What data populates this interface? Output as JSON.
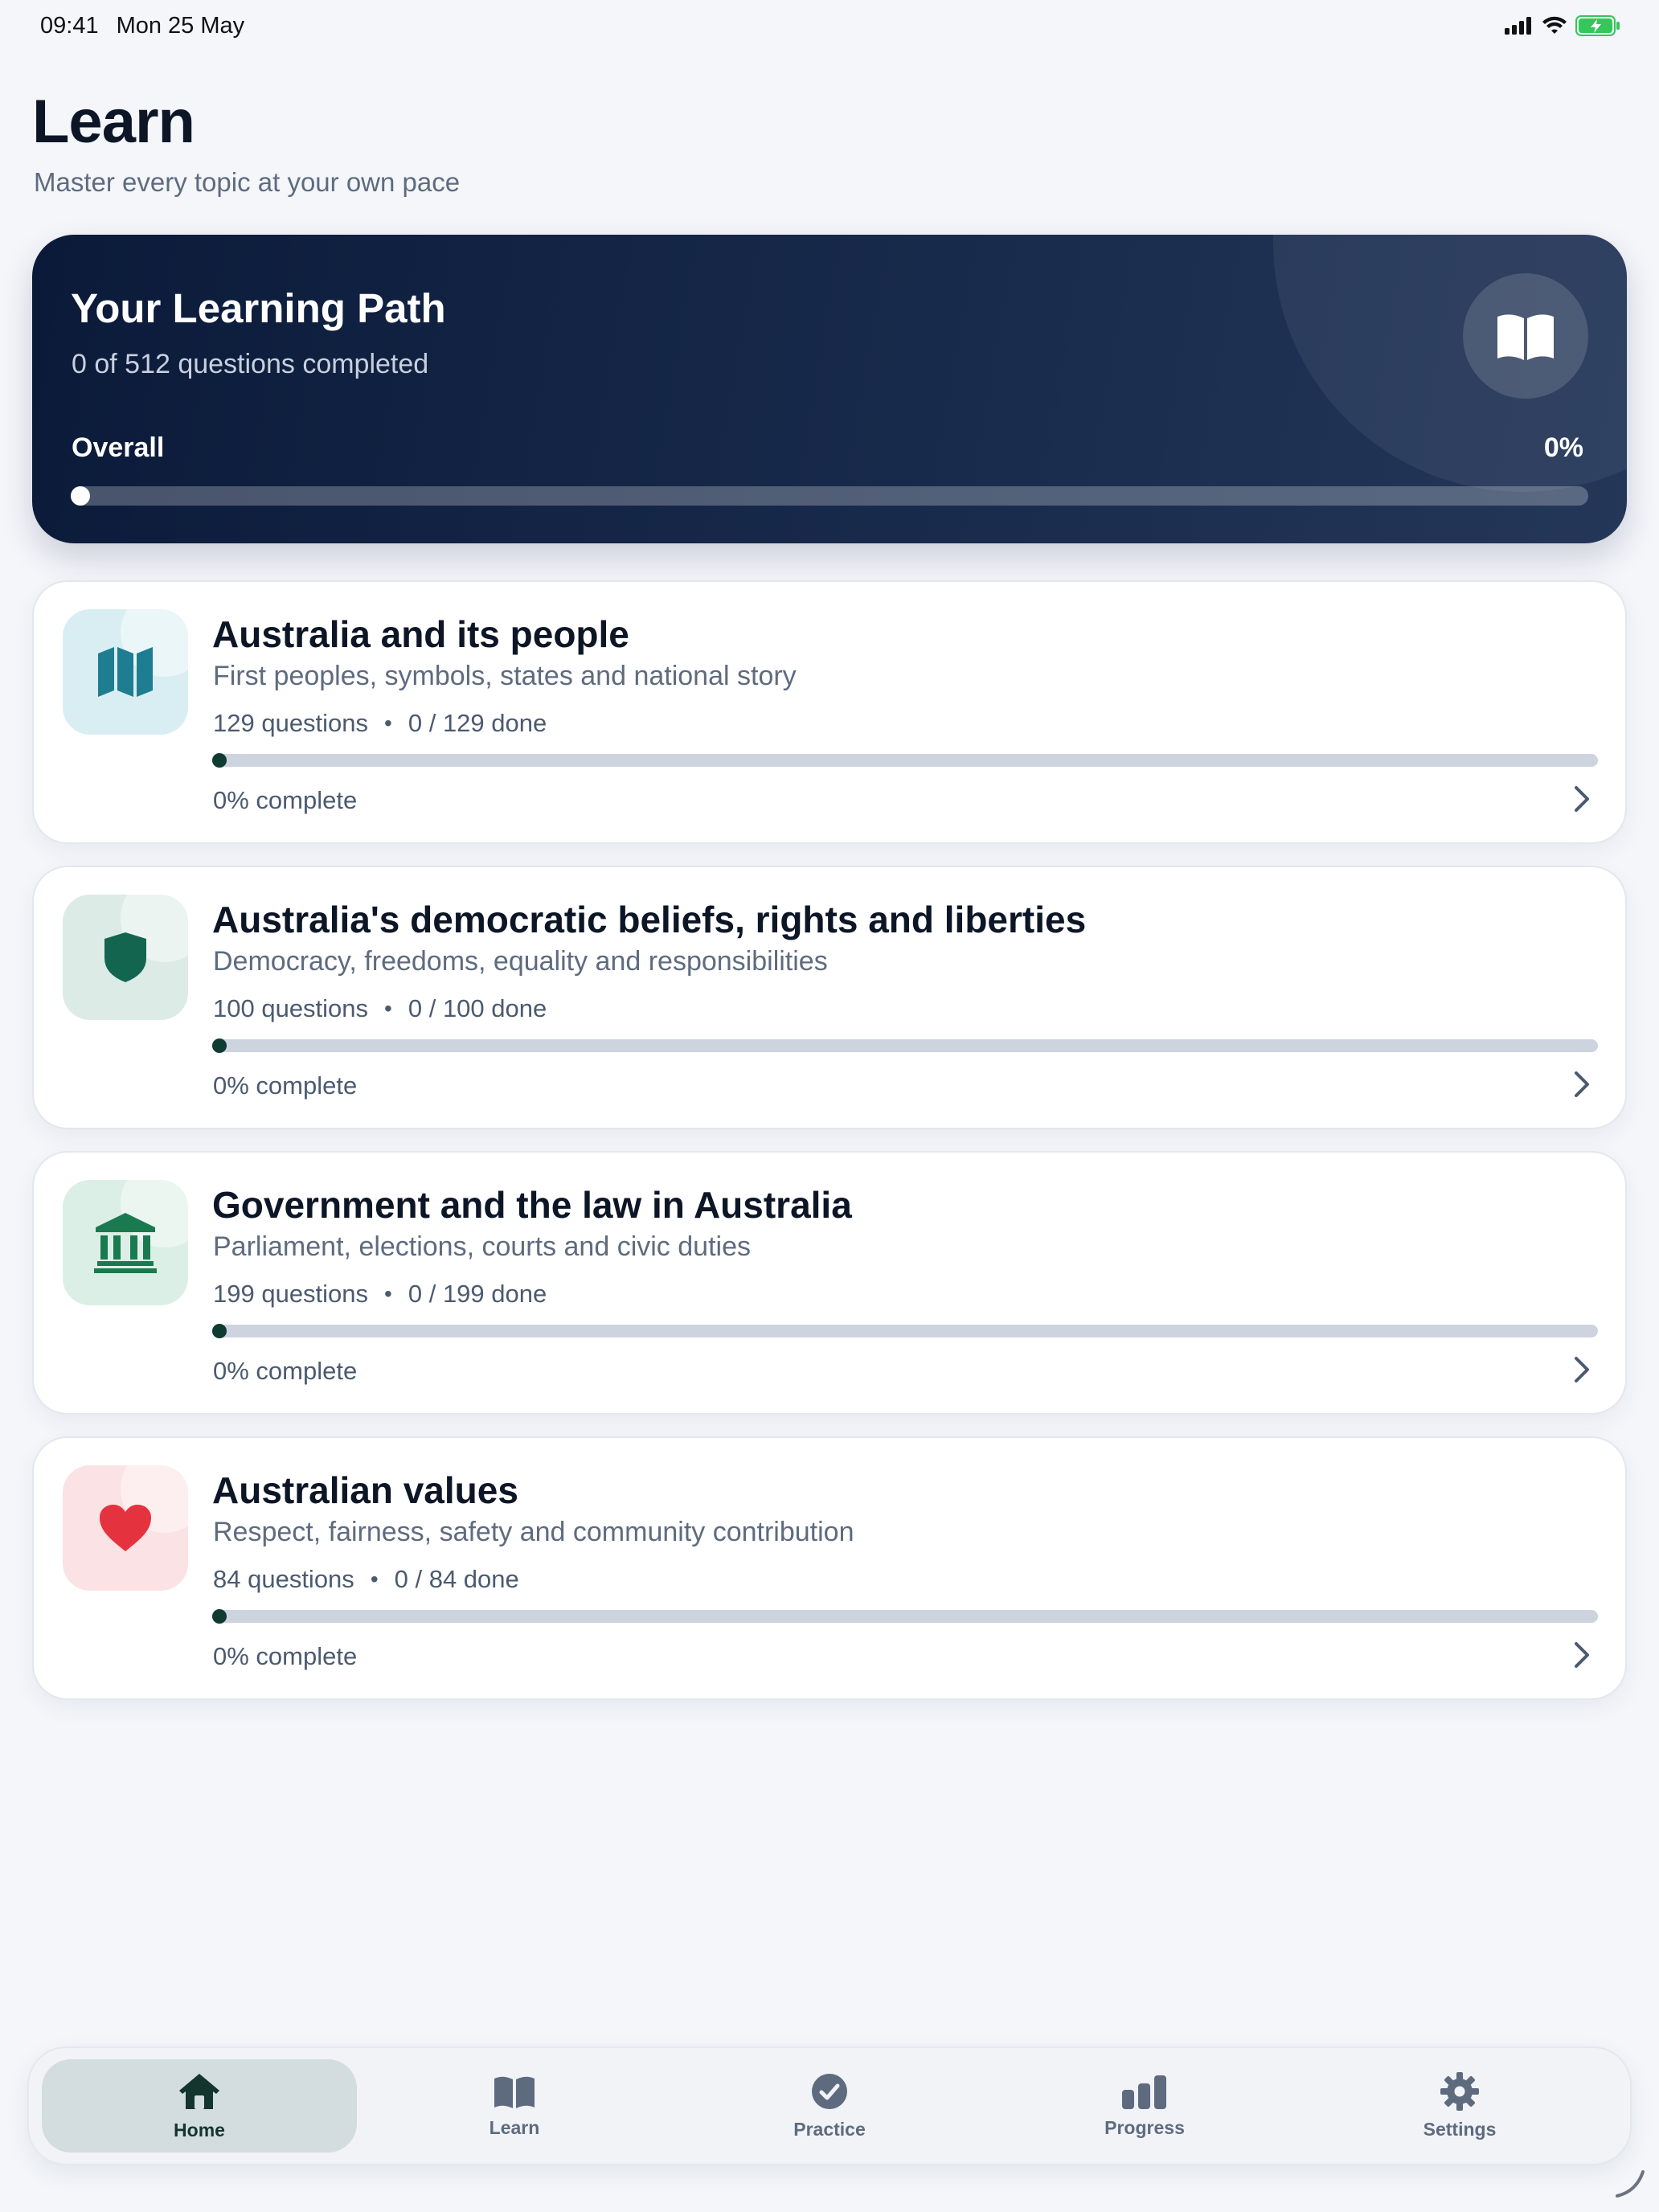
{
  "status_bar": {
    "time": "09:41",
    "date": "Mon 25 May",
    "battery_color": "#34c759"
  },
  "header": {
    "title": "Learn",
    "subtitle": "Master every topic at your own pace"
  },
  "hero": {
    "title": "Your Learning Path",
    "subtitle": "0 of 512 questions completed",
    "overall_label": "Overall",
    "overall_percent_text": "0%",
    "progress": 0,
    "icon": "open-book-icon"
  },
  "topics": [
    {
      "title": "Australia and its people",
      "description": "First peoples, symbols, states and national story",
      "questions": "129 questions",
      "done": "0 / 129 done",
      "percent_text": "0% complete",
      "progress": 0,
      "icon": "map-icon",
      "icon_color": "#1e7d91",
      "icon_bg": "#d9eef2"
    },
    {
      "title": "Australia's democratic beliefs, rights and liberties",
      "description": "Democracy, freedoms, equality and responsibilities",
      "questions": "100 questions",
      "done": "0 / 100 done",
      "percent_text": "0% complete",
      "progress": 0,
      "icon": "shield-icon",
      "icon_color": "#13654f",
      "icon_bg": "#dcebe6"
    },
    {
      "title": "Government and the law in Australia",
      "description": "Parliament, elections, courts and civic duties",
      "questions": "199 questions",
      "done": "0 / 199 done",
      "percent_text": "0% complete",
      "progress": 0,
      "icon": "parliament-building-icon",
      "icon_color": "#1a7a4f",
      "icon_bg": "#dcefe6"
    },
    {
      "title": "Australian values",
      "description": "Respect, fairness, safety and community contribution",
      "questions": "84 questions",
      "done": "0 / 84 done",
      "percent_text": "0% complete",
      "progress": 0,
      "icon": "heart-icon",
      "icon_color": "#e5323f",
      "icon_bg": "#fbe2e4"
    }
  ],
  "tabs": [
    {
      "label": "Home",
      "icon": "house-icon",
      "active": true
    },
    {
      "label": "Learn",
      "icon": "book-icon",
      "active": false
    },
    {
      "label": "Practice",
      "icon": "checkmark-circle-icon",
      "active": false
    },
    {
      "label": "Progress",
      "icon": "bar-chart-icon",
      "active": false
    },
    {
      "label": "Settings",
      "icon": "gear-icon",
      "active": false
    }
  ],
  "colors": {
    "accent": "#0f3b33",
    "hero_bg": "#0b1a39",
    "page_bg": "#f4f6fa"
  }
}
